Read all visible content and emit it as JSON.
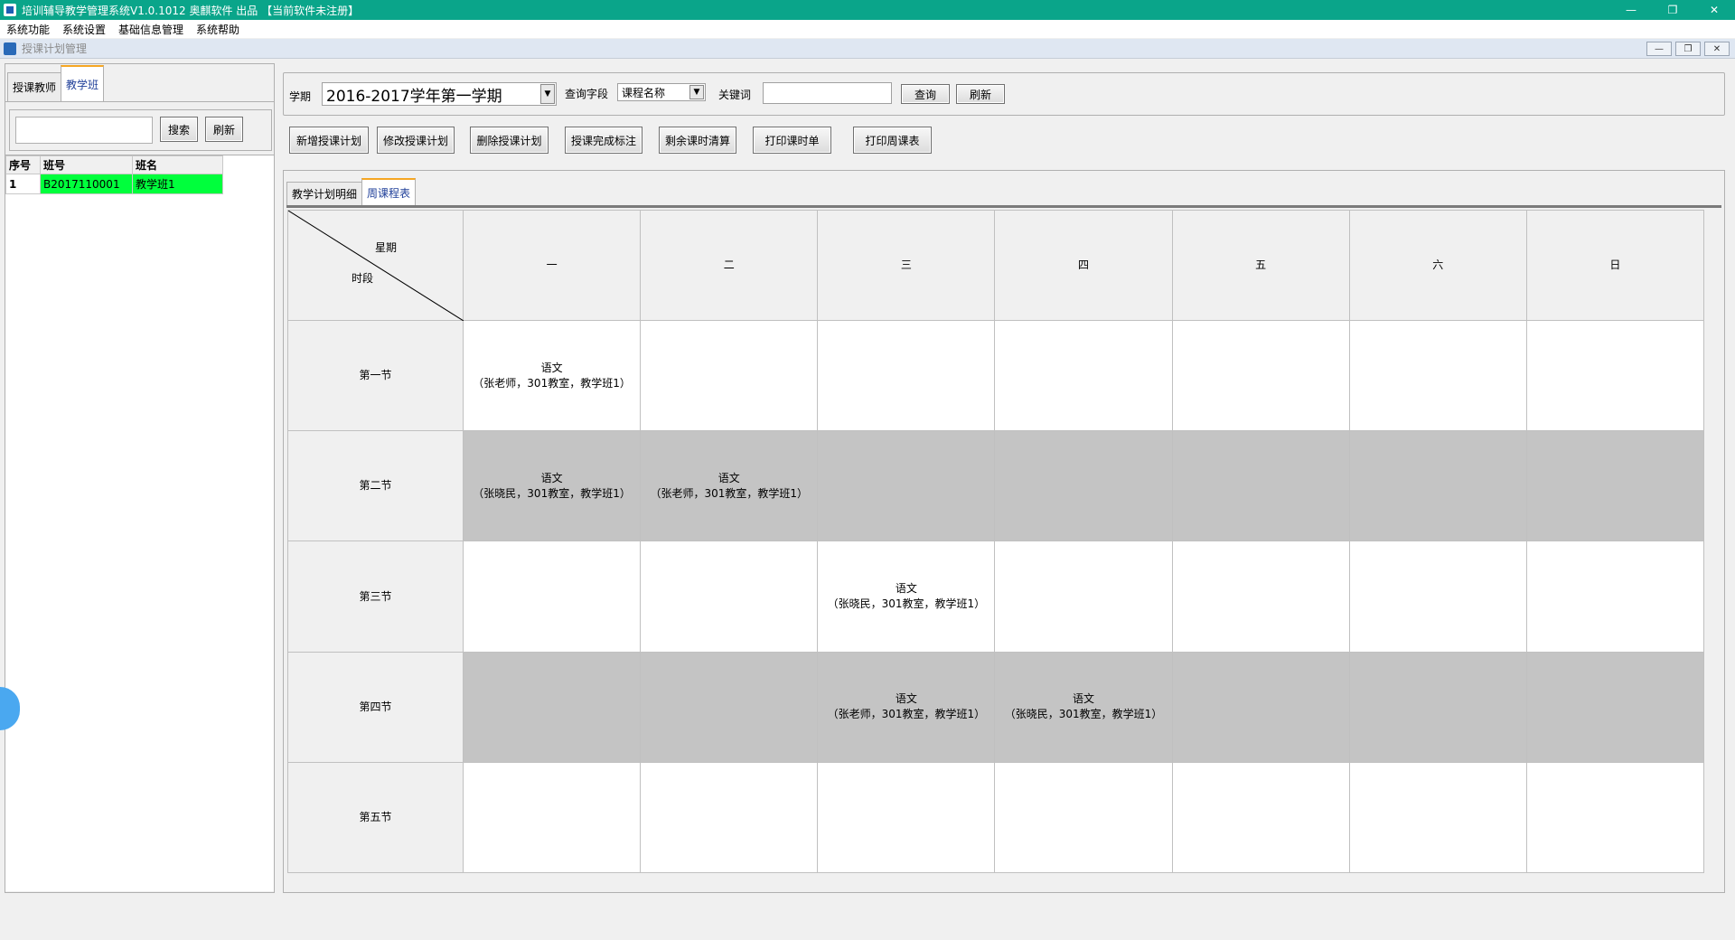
{
  "window": {
    "title": "培训辅导教学管理系统V1.0.1012 奥麒软件 出品 【当前软件未注册】",
    "controls": [
      "—",
      "❐",
      "✕"
    ]
  },
  "menu": [
    "系统功能",
    "系统设置",
    "基础信息管理",
    "系统帮助"
  ],
  "child_window": {
    "title": "授课计划管理"
  },
  "left": {
    "tabs": [
      "授课教师",
      "教学班"
    ],
    "search_button": "搜索",
    "refresh_button": "刷新",
    "columns": [
      "序号",
      "班号",
      "班名"
    ],
    "rows": [
      [
        "1",
        "B2017110001",
        "教学班1"
      ]
    ]
  },
  "filter": {
    "term_label": "学期",
    "term_value": "2016-2017学年第一学期",
    "field_label": "查询字段",
    "field_value": "课程名称",
    "keyword_label": "关键词",
    "query_button": "查询",
    "refresh_button": "刷新"
  },
  "toolbar": [
    "新增授课计划",
    "修改授课计划",
    "删除授课计划",
    "授课完成标注",
    "剩余课时清算",
    "打印课时单",
    "打印周课表"
  ],
  "view_tabs": [
    "教学计划明细",
    "周课程表"
  ],
  "timetable": {
    "corner_top": "星期",
    "corner_bottom": "时段",
    "days": [
      "一",
      "二",
      "三",
      "四",
      "五",
      "六",
      "日"
    ],
    "slots": [
      "第一节",
      "第二节",
      "第三节",
      "第四节",
      "第五节"
    ],
    "cells": [
      [
        [
          "语文",
          "（张老师，301教室，教学班1）"
        ],
        null,
        null,
        null,
        null,
        null,
        null
      ],
      [
        [
          "语文",
          "（张晓民，301教室，教学班1）"
        ],
        [
          "语文",
          "（张老师，301教室，教学班1）"
        ],
        null,
        null,
        null,
        null,
        null
      ],
      [
        null,
        null,
        [
          "语文",
          "（张晓民，301教室，教学班1）"
        ],
        null,
        null,
        null,
        null
      ],
      [
        null,
        null,
        [
          "语文",
          "（张老师，301教室，教学班1）"
        ],
        [
          "语文",
          "（张晓民，301教室，教学班1）"
        ],
        null,
        null,
        null
      ],
      [
        null,
        null,
        null,
        null,
        null,
        null,
        null
      ]
    ]
  },
  "colors": {
    "titlebar": "#0aa58a",
    "selected_row": "#00ff3c",
    "tab_accent": "#f5a623",
    "shaded_row": "#c4c4c4"
  }
}
